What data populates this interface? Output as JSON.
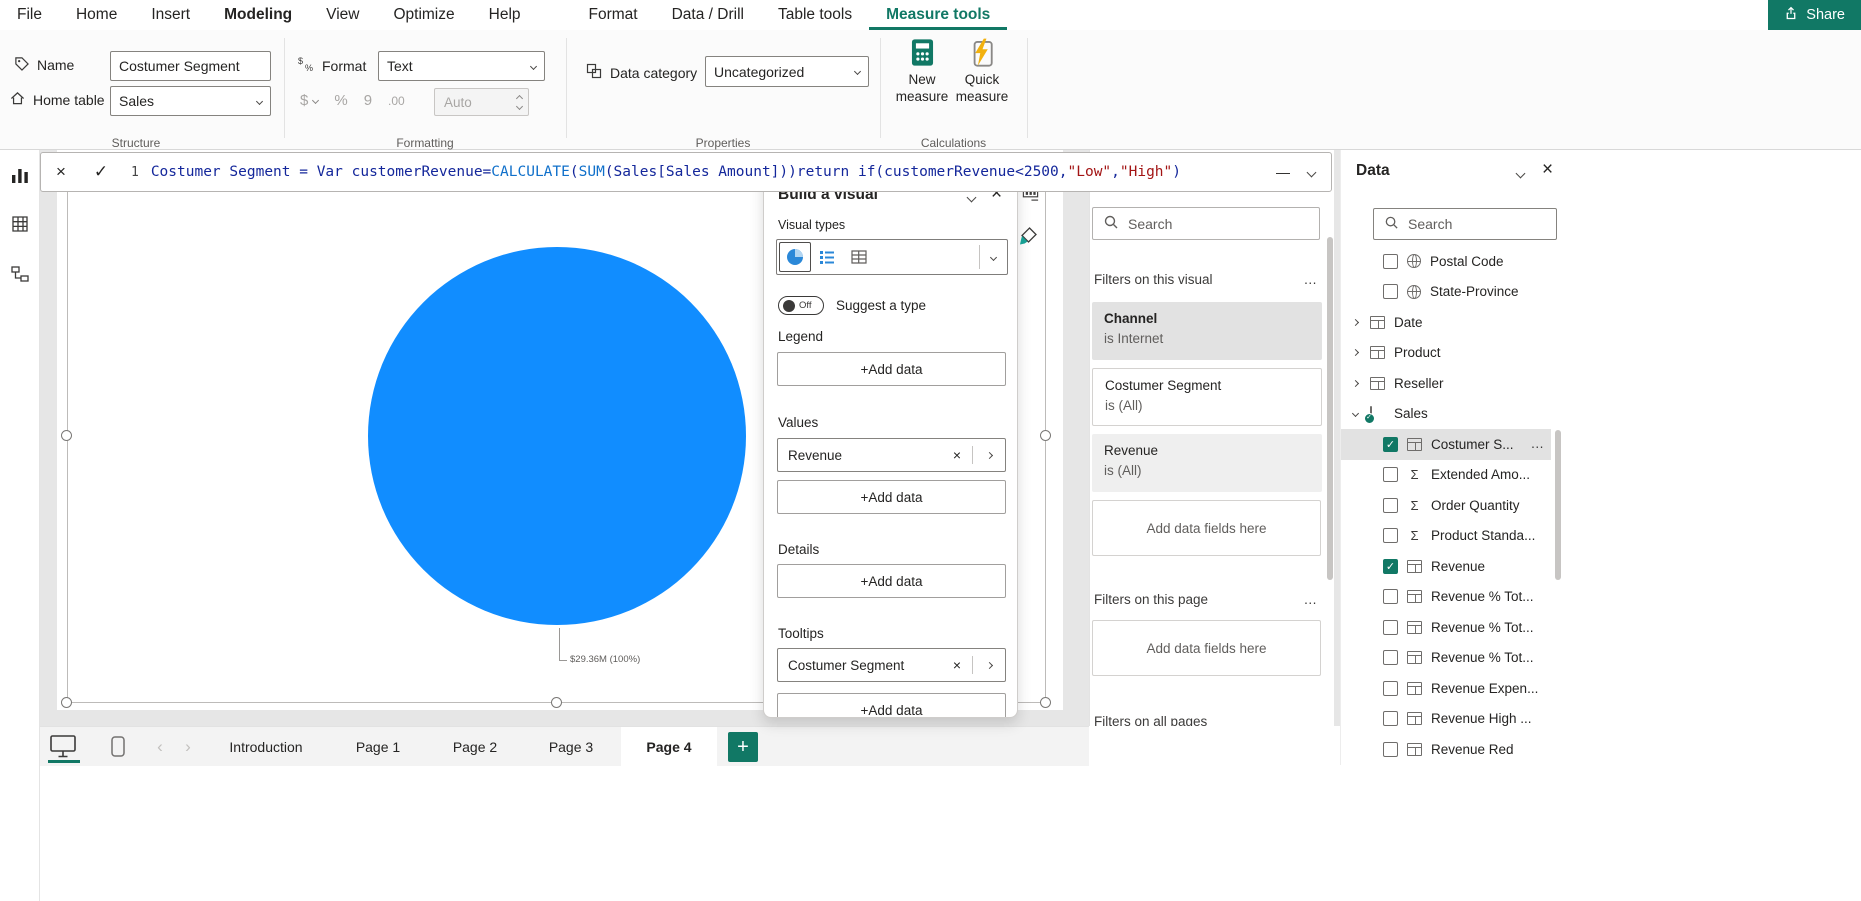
{
  "colors": {
    "accent": "#117865",
    "pie": "#118DFF"
  },
  "icons": {
    "close": "×",
    "check": "✓",
    "more": "…",
    "prev": "‹",
    "next": "›",
    "collapse": "—"
  },
  "menubar": {
    "items": [
      "File",
      "Home",
      "Insert",
      "Modeling",
      "View",
      "Optimize",
      "Help",
      "Format",
      "Data / Drill",
      "Table tools",
      "Measure tools"
    ],
    "share_label": "Share"
  },
  "ribbon": {
    "groups": [
      "Structure",
      "Formatting",
      "Properties",
      "Calculations"
    ],
    "name_label": "Name",
    "name_value": "Costumer Segment",
    "home_table_label": "Home table",
    "home_table_value": "Sales",
    "format_label": "Format",
    "format_value": "Text",
    "fmt_currency": "$",
    "fmt_percent": "%",
    "fmt_thousands": "9",
    "fmt_decimal": ".00",
    "auto_placeholder": "Auto",
    "data_category_label": "Data category",
    "data_category_value": "Uncategorized",
    "new_measure_line1": "New",
    "new_measure_line2": "measure",
    "quick_measure_line1": "Quick",
    "quick_measure_line2": "measure"
  },
  "formula_bar": {
    "line_number": "1",
    "segments": [
      {
        "text": "Costumer Segment = Var customerRevenue=",
        "color": "#14279b"
      },
      {
        "text": "CALCULATE",
        "color": "#1070ca"
      },
      {
        "text": "(",
        "color": "#14279b"
      },
      {
        "text": "SUM",
        "color": "#1070ca"
      },
      {
        "text": "(Sales[Sales Amount]))return if(customerRevenue<2500,",
        "color": "#14279b"
      },
      {
        "text": "\"Low\"",
        "color": "#a31515"
      },
      {
        "text": ",",
        "color": "#14279b"
      },
      {
        "text": "\"High\"",
        "color": "#a31515"
      },
      {
        "text": ")",
        "color": "#14279b"
      }
    ]
  },
  "canvas": {
    "pie_value_label": "$29.36M (100%)"
  },
  "chart_data": {
    "type": "pie",
    "series_field": "Revenue",
    "slices": [
      {
        "label": "$29.36M (100%)",
        "value": 29.36,
        "unit": "$M",
        "percent": 100,
        "color": "#118DFF"
      }
    ],
    "legend": "off"
  },
  "build_panel": {
    "title": "Build a visual",
    "visual_types_label": "Visual types",
    "toggle_label": "Off",
    "suggest_label": "Suggest a type",
    "legend_label": "Legend",
    "values_label": "Values",
    "details_label": "Details",
    "tooltips_label": "Tooltips",
    "add_data_label": "+Add data",
    "values_field": "Revenue",
    "tooltips_field": "Costumer Segment"
  },
  "filters_panel": {
    "search_placeholder": "Search",
    "heading_visual": "Filters on this visual",
    "heading_page": "Filters on this page",
    "heading_all": "Filters on all pages",
    "cards": [
      {
        "title": "Channel",
        "condition": "is Internet"
      },
      {
        "title": "Costumer Segment",
        "condition": "is (All)"
      },
      {
        "title": "Revenue",
        "condition": "is (All)"
      }
    ],
    "add_fields_label": "Add data fields here"
  },
  "data_panel": {
    "title": "Data",
    "search_placeholder": "Search",
    "fields": [
      {
        "label": "Postal Code"
      },
      {
        "label": "State-Province"
      },
      {
        "label": "Date"
      },
      {
        "label": "Product"
      },
      {
        "label": "Reseller"
      },
      {
        "label": "Sales"
      },
      {
        "label": "Costumer S..."
      },
      {
        "label": "Extended Amo..."
      },
      {
        "label": "Order Quantity"
      },
      {
        "label": "Product Standa..."
      },
      {
        "label": "Revenue"
      },
      {
        "label": "Revenue % Tot..."
      },
      {
        "label": "Revenue % Tot..."
      },
      {
        "label": "Revenue % Tot..."
      },
      {
        "label": "Revenue Expen..."
      },
      {
        "label": "Revenue High ..."
      },
      {
        "label": "Revenue Red"
      }
    ]
  },
  "pages_bar": {
    "tabs": [
      {
        "label": "Introduction"
      },
      {
        "label": "Page 1"
      },
      {
        "label": "Page 2"
      },
      {
        "label": "Page 3"
      },
      {
        "label": "Page 4",
        "active": true
      }
    ],
    "add_label": "+"
  }
}
